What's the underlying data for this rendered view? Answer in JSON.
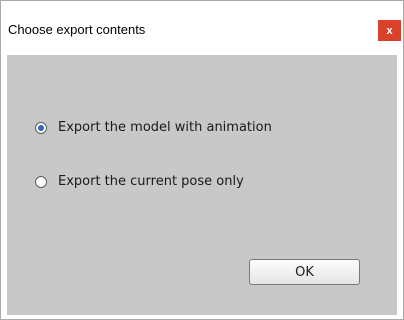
{
  "window": {
    "title": "Choose export contents",
    "close_label": "x"
  },
  "options": [
    {
      "label": "Export the model with animation",
      "selected": true
    },
    {
      "label": "Export the current pose only",
      "selected": false
    }
  ],
  "buttons": {
    "ok_label": "OK"
  },
  "colors": {
    "close_button": "#d9412a",
    "body_background": "#c8c8c8",
    "radio_dot": "#3466b4"
  }
}
